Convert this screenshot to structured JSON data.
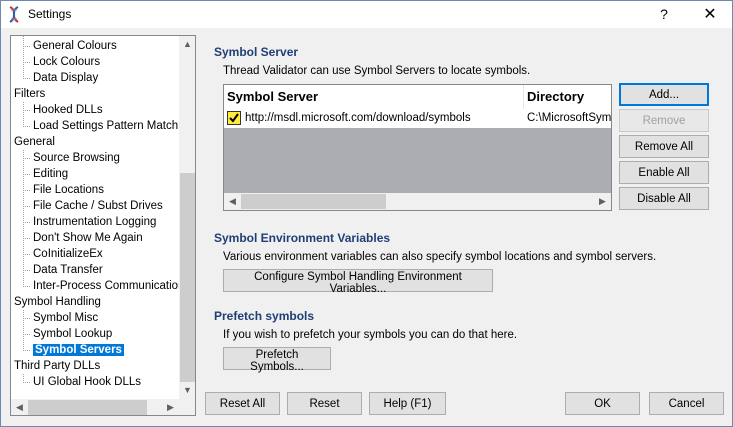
{
  "window": {
    "title": "Settings",
    "help_glyph": "?",
    "close_glyph": "✕"
  },
  "tree": {
    "items": [
      {
        "label": "General Colours",
        "level": 1
      },
      {
        "label": "Lock Colours",
        "level": 1
      },
      {
        "label": "Data Display",
        "level": 1
      },
      {
        "label": "Filters",
        "level": 0
      },
      {
        "label": "Hooked DLLs",
        "level": 1
      },
      {
        "label": "Load Settings Pattern Match",
        "level": 1
      },
      {
        "label": "General",
        "level": 0
      },
      {
        "label": "Source Browsing",
        "level": 1
      },
      {
        "label": "Editing",
        "level": 1
      },
      {
        "label": "File Locations",
        "level": 1
      },
      {
        "label": "File Cache / Subst Drives",
        "level": 1
      },
      {
        "label": "Instrumentation Logging",
        "level": 1
      },
      {
        "label": "Don't Show Me Again",
        "level": 1
      },
      {
        "label": "CoInitializeEx",
        "level": 1
      },
      {
        "label": "Data Transfer",
        "level": 1
      },
      {
        "label": "Inter-Process Communication",
        "level": 1
      },
      {
        "label": "Symbol Handling",
        "level": 0
      },
      {
        "label": "Symbol Misc",
        "level": 1
      },
      {
        "label": "Symbol Lookup",
        "level": 1
      },
      {
        "label": "Symbol Servers",
        "level": 1,
        "selected": true
      },
      {
        "label": "Third Party DLLs",
        "level": 0
      },
      {
        "label": "UI Global Hook DLLs",
        "level": 1
      }
    ]
  },
  "symbol_server": {
    "title": "Symbol Server",
    "description": "Thread Validator can use Symbol Servers to locate symbols.",
    "columns": [
      "Symbol Server",
      "Directory"
    ],
    "rows": [
      {
        "checked": true,
        "server": "http://msdl.microsoft.com/download/symbols",
        "directory": "C:\\MicrosoftSym"
      }
    ],
    "buttons": {
      "add": "Add...",
      "remove": "Remove",
      "remove_all": "Remove All",
      "enable_all": "Enable All",
      "disable_all": "Disable All"
    }
  },
  "env_vars": {
    "title": "Symbol Environment Variables",
    "description": "Various environment variables can also specify symbol locations and symbol servers.",
    "button": "Configure Symbol Handling Environment Variables..."
  },
  "prefetch": {
    "title": "Prefetch symbols",
    "description": "If you wish to prefetch your symbols you can do that here.",
    "button": "Prefetch Symbols..."
  },
  "footer": {
    "reset_all": "Reset All",
    "reset": "Reset",
    "help": "Help (F1)",
    "ok": "OK",
    "cancel": "Cancel"
  },
  "colors": {
    "accent": "#0078d7",
    "section_title": "#1f3f74"
  }
}
